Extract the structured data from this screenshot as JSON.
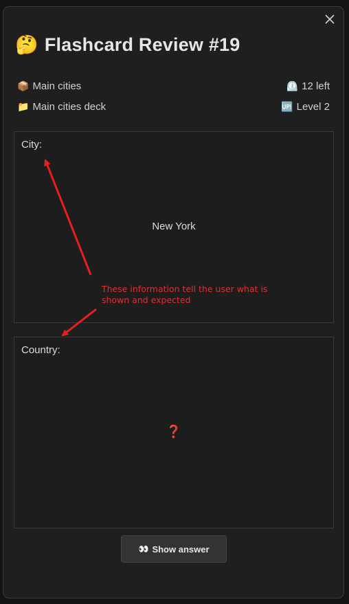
{
  "dialog": {
    "title_emoji": "🤔",
    "title": "Flashcard Review #19",
    "close_icon": "×"
  },
  "meta": {
    "deck_icon": "📦",
    "deck_name": "Main cities",
    "folder_icon": "📁",
    "folder_name": "Main cities deck",
    "remaining_icon": "⏲️",
    "remaining": "12 left",
    "level_icon": "🆙",
    "level": "Level 2"
  },
  "question_card": {
    "label": "City:",
    "value": "New York"
  },
  "answer_card": {
    "label": "Country:",
    "value": "❓"
  },
  "actions": {
    "show_answer_icon": "👀",
    "show_answer_label": "Show answer"
  },
  "annotation": {
    "text": "These information tell the user what is shown and expected",
    "color": "#e03030"
  }
}
